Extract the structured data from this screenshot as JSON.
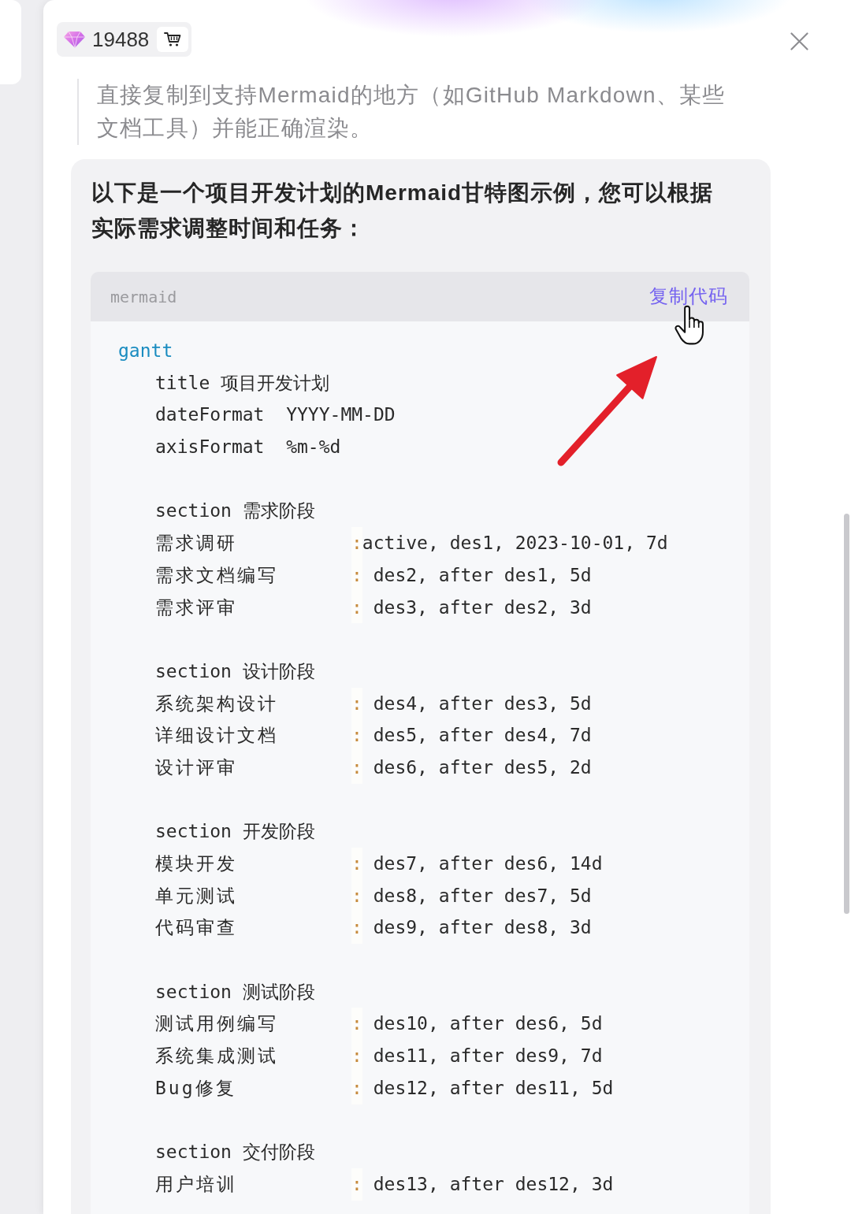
{
  "account": {
    "points": "19488"
  },
  "note": "直接复制到支持Mermaid的地方（如GitHub Markdown、某些文档工具）并能正确渲染。",
  "message": {
    "intro": "以下是一个项目开发计划的Mermaid甘特图示例，您可以根据实际需求调整时间和任务：",
    "code": {
      "language": "mermaid",
      "copy_label": "复制代码",
      "keyword": "gantt",
      "settings": [
        "title 项目开发计划",
        "dateFormat  YYYY-MM-DD",
        "axisFormat  %m-%d"
      ],
      "sections": [
        {
          "heading": "section 需求阶段",
          "tasks": [
            {
              "name": "需求调研",
              "separator": ":",
              "value": "active, des1, 2023-10-01, 7d"
            },
            {
              "name": "需求文档编写",
              "separator": ":",
              "value": " des2, after des1, 5d"
            },
            {
              "name": "需求评审",
              "separator": ":",
              "value": " des3, after des2, 3d"
            }
          ]
        },
        {
          "heading": "section 设计阶段",
          "tasks": [
            {
              "name": "系统架构设计",
              "separator": ":",
              "value": " des4, after des3, 5d"
            },
            {
              "name": "详细设计文档",
              "separator": ":",
              "value": " des5, after des4, 7d"
            },
            {
              "name": "设计评审",
              "separator": ":",
              "value": " des6, after des5, 2d"
            }
          ]
        },
        {
          "heading": "section 开发阶段",
          "tasks": [
            {
              "name": "模块开发",
              "separator": ":",
              "value": " des7, after des6, 14d"
            },
            {
              "name": "单元测试",
              "separator": ":",
              "value": " des8, after des7, 5d"
            },
            {
              "name": "代码审查",
              "separator": ":",
              "value": " des9, after des8, 3d"
            }
          ]
        },
        {
          "heading": "section 测试阶段",
          "tasks": [
            {
              "name": "测试用例编写",
              "separator": ":",
              "value": " des10, after des6, 5d"
            },
            {
              "name": "系统集成测试",
              "separator": ":",
              "value": " des11, after des9, 7d"
            },
            {
              "name": "Bug修复",
              "separator": ":",
              "value": " des12, after des11, 5d"
            }
          ]
        },
        {
          "heading": "section 交付阶段",
          "tasks": [
            {
              "name": "用户培训",
              "separator": ":",
              "value": " des13, after des12, 3d"
            }
          ]
        }
      ]
    }
  }
}
